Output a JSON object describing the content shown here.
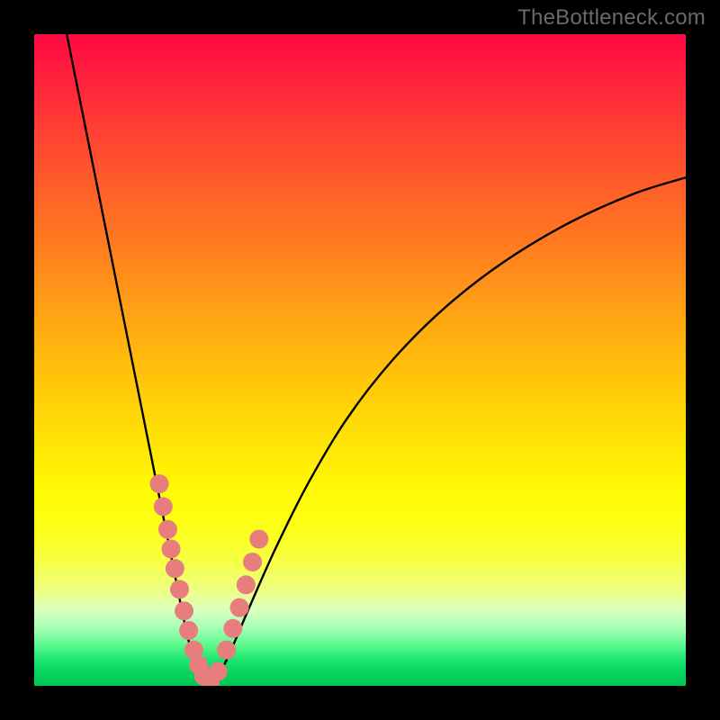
{
  "watermark": "TheBottleneck.com",
  "chart_data": {
    "type": "line",
    "title": "",
    "xlabel": "",
    "ylabel": "",
    "xlim": [
      0,
      100
    ],
    "ylim": [
      0,
      100
    ],
    "grid": false,
    "legend": false,
    "series": [
      {
        "name": "left-branch",
        "x": [
          5,
          7,
          9,
          11,
          13,
          15,
          17,
          19,
          21,
          23,
          24.5,
          26,
          27
        ],
        "values": [
          100,
          90,
          80,
          70,
          60,
          50,
          40,
          30,
          20,
          10,
          4,
          1,
          0
        ]
      },
      {
        "name": "right-branch",
        "x": [
          27,
          28,
          30,
          33,
          37,
          42,
          48,
          55,
          63,
          72,
          82,
          92,
          100
        ],
        "values": [
          0,
          1,
          5,
          12,
          21,
          31,
          41,
          50,
          58,
          65,
          71,
          75.5,
          78
        ]
      }
    ],
    "markers": {
      "name": "highlighted-points",
      "x": [
        19.2,
        19.8,
        20.5,
        21.0,
        21.6,
        22.3,
        23.0,
        23.7,
        24.5,
        25.2,
        26.0,
        27.0,
        28.2,
        29.5,
        30.5,
        31.5,
        32.5,
        33.5,
        34.5
      ],
      "values": [
        31.0,
        27.5,
        24.0,
        21.0,
        18.0,
        14.8,
        11.5,
        8.5,
        5.5,
        3.2,
        1.5,
        0.5,
        2.2,
        5.5,
        8.8,
        12.0,
        15.5,
        19.0,
        22.5
      ]
    },
    "background_gradient": {
      "top": "#ff0a42",
      "bottom": "#00c853"
    }
  }
}
